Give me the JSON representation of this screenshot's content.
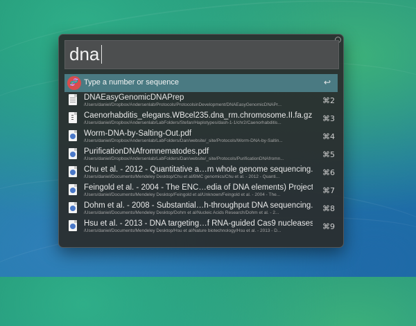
{
  "search": {
    "query": "dna"
  },
  "top_action": {
    "label": "Type a number or sequence",
    "badge_icon": "dna-icon",
    "key_icon": "return-icon"
  },
  "results": [
    {
      "title": "DNAEasyGenomicDNAPrep",
      "path": "/Users/daniel/Dropbox/Andersenlab/Protocols/ProtocolsinDevelopment/DNAEasyGenomicDNAPr...",
      "shortcut": "⌘2",
      "icon": "document-icon"
    },
    {
      "title": "Caenorhabditis_elegans.WBcel235.dna_rm.chromosome.II.fa.gz",
      "path": "/Users/daniel/Dropbox/Andersenlab/LabFolders/Stefan/Haplotypes/dash-1-1/chr2/Caenorhabditis...",
      "shortcut": "⌘3",
      "icon": "archive-icon"
    },
    {
      "title": "Worm-DNA-by-Salting-Out.pdf",
      "path": "/Users/daniel/Dropbox/Andersenlab/LabFolders/Dan/website/_site/Protocols/Worm-DNA-by-Saltin...",
      "shortcut": "⌘4",
      "icon": "pdf-icon"
    },
    {
      "title": "PurificationDNAfromnematodes.pdf",
      "path": "/Users/daniel/Dropbox/Andersenlab/LabFolders/Dan/website/_site/Protocols/PurificationDNAfromn...",
      "shortcut": "⌘5",
      "icon": "pdf-icon"
    },
    {
      "title": "Chu et al. - 2012 - Quantitative a…m whole genome sequencing.pdf",
      "path": "/Users/daniel/Documents/Mendeley Desktop/Chu et al/BMC genomics/Chu et al. - 2012 - Quanti...",
      "shortcut": "⌘6",
      "icon": "pdf-icon"
    },
    {
      "title": "Feingold et al. - 2004 - The ENC…edia of DNA elements) Project.pdf",
      "path": "/Users/daniel/Documents/Mendeley Desktop/Feingold et al/Unknown/Feingold et al. - 2004 - The...",
      "shortcut": "⌘7",
      "icon": "pdf-icon"
    },
    {
      "title": "Dohm et al. - 2008 - Substantial…h-throughput DNA sequencing.pdf",
      "path": "/Users/daniel/Documents/Mendeley Desktop/Dohm et al/Nucleic Acids Research/Dohm et al. - 2...",
      "shortcut": "⌘8",
      "icon": "pdf-icon"
    },
    {
      "title": "Hsu et al. - 2013 - DNA targeting…f RNA-guided Cas9 nucleases.pdf",
      "path": "/Users/daniel/Documents/Mendeley Desktop/Hsu et al/Nature biotechnology/Hsu et al. - 2013 - D...",
      "shortcut": "⌘9",
      "icon": "pdf-icon"
    }
  ]
}
